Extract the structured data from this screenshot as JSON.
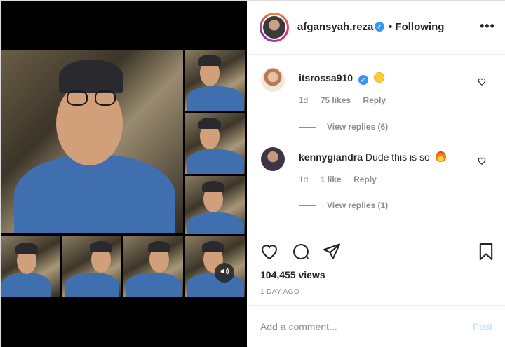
{
  "header": {
    "username": "afgansyah.reza",
    "following_label": "• Following",
    "more_icon": "more-options-icon"
  },
  "comments": [
    {
      "username": "itsrossa910",
      "text": "",
      "emoji": "star-struck-emoji",
      "time": "1d",
      "likes": "75 likes",
      "reply_label": "Reply",
      "view_replies": "View replies (6)"
    },
    {
      "username": "kennygiandra",
      "text": "Dude this is so",
      "emoji": "fire-emoji",
      "time": "1d",
      "likes": "1 like",
      "reply_label": "Reply",
      "view_replies": "View replies (1)"
    }
  ],
  "actions": {
    "icons": [
      "heart-icon",
      "comment-icon",
      "share-icon",
      "bookmark-icon"
    ],
    "views": "104,455 views",
    "date": "1 DAY AGO"
  },
  "comment_box": {
    "placeholder": "Add a comment...",
    "post_label": "Post"
  },
  "media": {
    "mute_icon": "speaker-icon"
  },
  "colors": {
    "verified_blue": "#3897f0",
    "post_disabled": "#b2dffc",
    "meta_gray": "#8e8e8e"
  }
}
